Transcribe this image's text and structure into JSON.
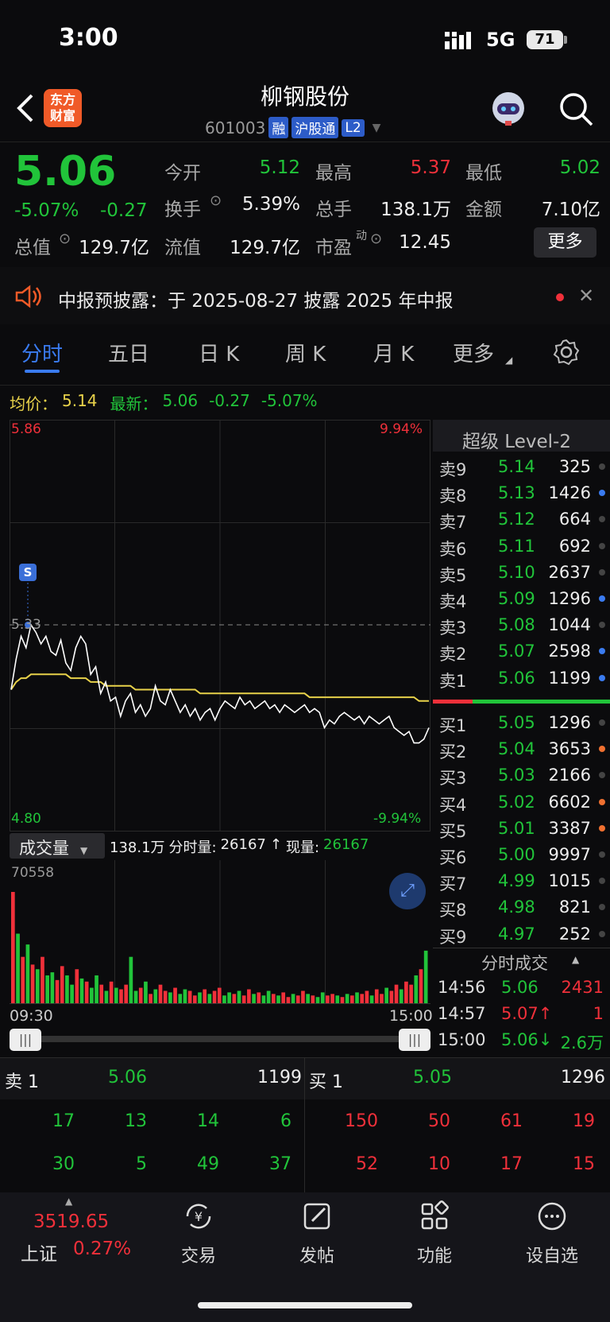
{
  "status": {
    "time": "3:00",
    "network": "5G",
    "battery": "71"
  },
  "header": {
    "title": "柳钢股份",
    "code": "601003",
    "tags": [
      "融",
      "沪股通",
      "L2"
    ],
    "logo": [
      "东方",
      "财富"
    ]
  },
  "quote": {
    "price": "5.06",
    "change_pct": "-5.07%",
    "change": "-0.27",
    "open_label": "今开",
    "open": "5.12",
    "high_label": "最高",
    "high": "5.37",
    "low_label": "最低",
    "low": "5.02",
    "turnover_label": "换手",
    "turnover": "5.39%",
    "volume_label": "总手",
    "volume": "138.1万",
    "amount_label": "金额",
    "amount": "7.10亿",
    "mktcap_label": "总值",
    "mktcap": "129.7亿",
    "float_label": "流值",
    "float_cap": "129.7亿",
    "pe_label": "市盈",
    "pe_sup": "动",
    "pe": "12.45",
    "more": "更多"
  },
  "notice": {
    "text": "中报预披露：于 2025-08-27 披露 2025 年中报"
  },
  "tabs": [
    "分时",
    "五日",
    "日 K",
    "周 K",
    "月 K",
    "更多"
  ],
  "chart_info": {
    "avg_label": "均价：",
    "avg": "5.14",
    "latest_label": "最新：",
    "latest": "5.06",
    "latest_change": "-0.27",
    "latest_pct": "-5.07%"
  },
  "chart_data": {
    "type": "line",
    "y_top": "5.86",
    "y_bottom": "4.80",
    "pct_top": "9.94%",
    "pct_bottom": "-9.94%",
    "ref_label": "5.33",
    "ylim": [
      4.8,
      5.86
    ],
    "ref_price": 5.33,
    "price": [
      5.16,
      5.24,
      5.3,
      5.27,
      5.33,
      5.31,
      5.28,
      5.3,
      5.26,
      5.25,
      5.29,
      5.23,
      5.21,
      5.27,
      5.3,
      5.28,
      5.2,
      5.22,
      5.15,
      5.18,
      5.13,
      5.14,
      5.09,
      5.13,
      5.15,
      5.1,
      5.12,
      5.09,
      5.11,
      5.17,
      5.13,
      5.12,
      5.16,
      5.13,
      5.1,
      5.12,
      5.09,
      5.11,
      5.08,
      5.1,
      5.11,
      5.08,
      5.11,
      5.13,
      5.12,
      5.11,
      5.14,
      5.12,
      5.13,
      5.11,
      5.12,
      5.13,
      5.11,
      5.12,
      5.1,
      5.12,
      5.11,
      5.1,
      5.11,
      5.12,
      5.1,
      5.11,
      5.1,
      5.06,
      5.08,
      5.07,
      5.09,
      5.1,
      5.09,
      5.08,
      5.09,
      5.07,
      5.09,
      5.08,
      5.07,
      5.08,
      5.09,
      5.06,
      5.05,
      5.04,
      5.05,
      5.02,
      5.02,
      5.03,
      5.06
    ],
    "avg_line": [
      5.16,
      5.18,
      5.19,
      5.19,
      5.2,
      5.2,
      5.2,
      5.2,
      5.2,
      5.2,
      5.2,
      5.2,
      5.19,
      5.19,
      5.19,
      5.19,
      5.18,
      5.18,
      5.18,
      5.17,
      5.17,
      5.17,
      5.17,
      5.17,
      5.17,
      5.16,
      5.16,
      5.16,
      5.16,
      5.16,
      5.16,
      5.16,
      5.16,
      5.16,
      5.16,
      5.16,
      5.16,
      5.16,
      5.15,
      5.15,
      5.15,
      5.15,
      5.15,
      5.15,
      5.15,
      5.15,
      5.15,
      5.15,
      5.15,
      5.15,
      5.15,
      5.15,
      5.15,
      5.15,
      5.15,
      5.15,
      5.15,
      5.15,
      5.15,
      5.15,
      5.14,
      5.14,
      5.14,
      5.14,
      5.14,
      5.14,
      5.14,
      5.14,
      5.14,
      5.14,
      5.14,
      5.14,
      5.14,
      5.14,
      5.14,
      5.14,
      5.14,
      5.14,
      5.14,
      5.14,
      5.14,
      5.14,
      5.13,
      5.13,
      5.13
    ],
    "signal": "S",
    "x_start": "09:30",
    "x_end": "15:00"
  },
  "volume": {
    "label": "成交量",
    "total": "138.1万",
    "minute_label": "分时量:",
    "minute": "26167",
    "current_label": "现量:",
    "current": "26167",
    "max": "70558",
    "bars": [
      72,
      45,
      30,
      38,
      25,
      22,
      30,
      18,
      20,
      15,
      24,
      18,
      12,
      22,
      16,
      14,
      10,
      18,
      12,
      8,
      14,
      10,
      9,
      12,
      30,
      8,
      10,
      14,
      6,
      9,
      12,
      8,
      7,
      10,
      6,
      9,
      8,
      5,
      7,
      9,
      6,
      8,
      10,
      5,
      7,
      6,
      8,
      5,
      9,
      6,
      7,
      5,
      8,
      6,
      5,
      7,
      4,
      6,
      5,
      8,
      6,
      5,
      4,
      7,
      5,
      6,
      5,
      4,
      6,
      5,
      7,
      6,
      8,
      5,
      9,
      6,
      10,
      8,
      12,
      9,
      14,
      12,
      18,
      22,
      34
    ],
    "bar_colors": [
      "r",
      "g",
      "r",
      "g",
      "r",
      "g",
      "r",
      "g",
      "g",
      "r",
      "r",
      "g",
      "g",
      "r",
      "g",
      "r",
      "g",
      "g",
      "r",
      "g",
      "r",
      "g",
      "r",
      "r",
      "g",
      "g",
      "r",
      "g",
      "r",
      "g",
      "r",
      "r",
      "g",
      "r",
      "g",
      "g",
      "r",
      "r",
      "g",
      "r",
      "g",
      "r",
      "r",
      "g",
      "g",
      "r",
      "g",
      "r",
      "r",
      "g",
      "r",
      "g",
      "g",
      "r",
      "g",
      "r",
      "r",
      "g",
      "r",
      "r",
      "g",
      "r",
      "g",
      "g",
      "r",
      "r",
      "g",
      "r",
      "g",
      "r",
      "g",
      "r",
      "r",
      "g",
      "r",
      "r",
      "g",
      "r",
      "r",
      "g",
      "r",
      "r",
      "g",
      "r",
      "g"
    ]
  },
  "orderbook": {
    "title": "超级 Level-2",
    "asks": [
      {
        "label": "卖9",
        "price": "5.14",
        "qty": "325"
      },
      {
        "label": "卖8",
        "price": "5.13",
        "qty": "1426"
      },
      {
        "label": "卖7",
        "price": "5.12",
        "qty": "664"
      },
      {
        "label": "卖6",
        "price": "5.11",
        "qty": "692"
      },
      {
        "label": "卖5",
        "price": "5.10",
        "qty": "2637"
      },
      {
        "label": "卖4",
        "price": "5.09",
        "qty": "1296"
      },
      {
        "label": "卖3",
        "price": "5.08",
        "qty": "1044"
      },
      {
        "label": "卖2",
        "price": "5.07",
        "qty": "2598"
      },
      {
        "label": "卖1",
        "price": "5.06",
        "qty": "1199"
      }
    ],
    "bids": [
      {
        "label": "买1",
        "price": "5.05",
        "qty": "1296"
      },
      {
        "label": "买2",
        "price": "5.04",
        "qty": "3653"
      },
      {
        "label": "买3",
        "price": "5.03",
        "qty": "2166"
      },
      {
        "label": "买4",
        "price": "5.02",
        "qty": "6602"
      },
      {
        "label": "买5",
        "price": "5.01",
        "qty": "3387"
      },
      {
        "label": "买6",
        "price": "5.00",
        "qty": "9997"
      },
      {
        "label": "买7",
        "price": "4.99",
        "qty": "1015"
      },
      {
        "label": "买8",
        "price": "4.98",
        "qty": "821"
      },
      {
        "label": "买9",
        "price": "4.97",
        "qty": "252"
      }
    ]
  },
  "trades": {
    "title": "分时成交",
    "rows": [
      {
        "time": "14:56",
        "price": "5.06",
        "qty": "2431"
      },
      {
        "time": "14:57",
        "price": "5.07↑",
        "qty": "1"
      },
      {
        "time": "15:00",
        "price": "5.06↓",
        "qty": "2.6万"
      }
    ]
  },
  "queue": {
    "ask_label": "卖 1",
    "ask_price": "5.06",
    "ask_qty": "1199",
    "bid_label": "买 1",
    "bid_price": "5.05",
    "bid_qty": "1296",
    "ask_row1": [
      "17",
      "13",
      "14",
      "6"
    ],
    "ask_row2": [
      "30",
      "5",
      "49",
      "37"
    ],
    "bid_row1": [
      "150",
      "50",
      "61",
      "19"
    ],
    "bid_row2": [
      "52",
      "10",
      "17",
      "15"
    ]
  },
  "bottom": {
    "index_value": "3519.65",
    "index_name": "上证",
    "index_pct": "0.27%",
    "items": [
      "交易",
      "发帖",
      "功能",
      "设自选"
    ]
  },
  "colors": {
    "up": "#f0303a",
    "down": "#21c43a",
    "accent": "#3a7bf0",
    "avg_line": "#e8d24a"
  }
}
